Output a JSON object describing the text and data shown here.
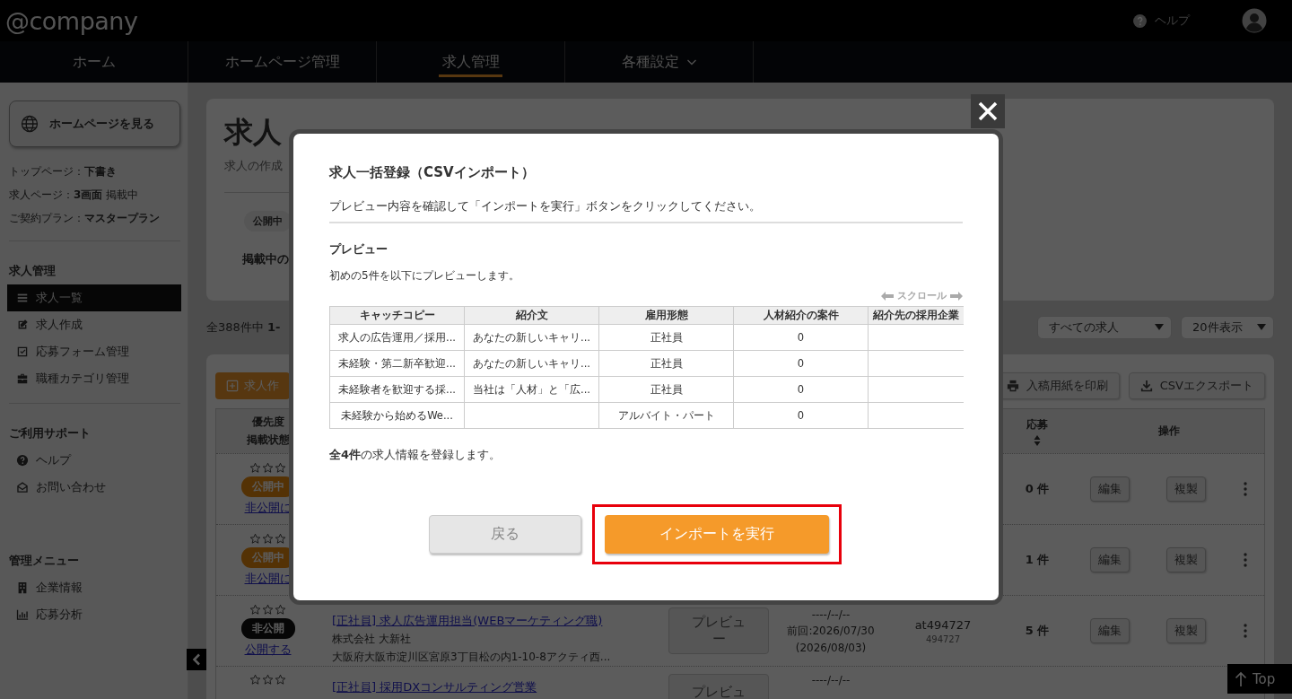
{
  "header": {
    "logo": "@company",
    "help": "ヘルプ"
  },
  "nav": {
    "tabs": [
      {
        "label": "ホーム",
        "selected": false,
        "dropdown": false
      },
      {
        "label": "ホームページ管理",
        "selected": false,
        "dropdown": false
      },
      {
        "label": "求人管理",
        "selected": true,
        "dropdown": false
      },
      {
        "label": "各種設定",
        "selected": false,
        "dropdown": true
      }
    ]
  },
  "sidebar": {
    "view_button": "ホームページを見る",
    "info": [
      "トップページ：**下書き**",
      "求人ページ：**3画面** 掲載中",
      "ご契約プラン：**マスタープラン**"
    ],
    "sections": [
      {
        "title": "求人管理",
        "items": [
          {
            "label": "求人一覧",
            "kind": "list",
            "selected": true
          },
          {
            "label": "求人作成",
            "kind": "edit",
            "selected": false
          },
          {
            "label": "応募フォーム管理",
            "kind": "checkbox",
            "selected": false
          },
          {
            "label": "職種カテゴリ管理",
            "kind": "briefcase",
            "selected": false
          }
        ]
      },
      {
        "title": "ご利用サポート",
        "items": [
          {
            "label": "ヘルプ",
            "kind": "help",
            "selected": false
          },
          {
            "label": "お問い合わせ",
            "kind": "mail",
            "selected": false
          }
        ]
      },
      {
        "title": "管理メニュー",
        "items": [
          {
            "label": "企業情報",
            "kind": "building",
            "selected": false
          },
          {
            "label": "応募分析",
            "kind": "chart",
            "selected": false
          }
        ]
      }
    ]
  },
  "main": {
    "title": "求人",
    "subtitle": "求人の作成",
    "status_pill": "公開中",
    "listing_label": "掲載中の",
    "count_text": "全388件中 **1-**",
    "filters": [
      "すべての求人",
      "20件表示"
    ],
    "create_button": "求人作",
    "toolbar_buttons": [
      "入稿用紙を印刷",
      "CSVエクスポート"
    ],
    "table": {
      "status_header": [
        "優先度",
        "掲載状態"
      ],
      "applications_header": "応募",
      "actions_header": "操作",
      "rows": [
        {
          "stars": 0,
          "status": "公開中",
          "kind": "published",
          "toggle_link": "非公開に",
          "applications": "0 件",
          "edit": "編集",
          "copy": "複製"
        },
        {
          "stars": 0,
          "status": "公開中",
          "kind": "published",
          "toggle_link": "非公開に",
          "applications": "1 件",
          "edit": "編集",
          "copy": "複製"
        },
        {
          "stars": 0,
          "status": "非公開",
          "kind": "private",
          "toggle_link": "公開する",
          "title_link": "[正社員] 求人広告運用担当(WEBマーケティング職)",
          "company": "株式会社 大新社",
          "address": "大阪府大阪市淀川区宮原3丁目松の内1-10-8アクティ西...",
          "preview": "プレビュー",
          "dates": [
            "----/--/--",
            "前回:2026/07/30",
            "(2026/08/03)"
          ],
          "code": "at494727",
          "code_sub": "494727",
          "applications": "5 件",
          "edit": "編集",
          "copy": "複製"
        },
        {
          "stars": 0,
          "title_link": "[正社員] 採用DXコンサルティング営業",
          "preview": "プレビュ",
          "dates": [
            "----/--/--"
          ]
        }
      ]
    }
  },
  "modal": {
    "title": "求人一括登録（CSVインポート）",
    "instruction": "プレビュー内容を確認して「インポートを実行」ボタンをクリックしてください。",
    "preview_heading": "プレビュー",
    "preview_note": "初めの5件を以下にプレビューします。",
    "scroll_hint": "スクロール",
    "table": {
      "columns": [
        "キャッチコピー",
        "紹介文",
        "雇用形態",
        "人材紹介の案件",
        "紹介先の採用企業"
      ],
      "rows": [
        {
          "catch_copy": "求人の広告運用／採用...",
          "intro": "あなたの新しいキャリ...",
          "employment_type": "正社員",
          "agency_cases": "0"
        },
        {
          "catch_copy": "未経験・第二新卒歓迎...",
          "intro": "あなたの新しいキャリ...",
          "employment_type": "正社員",
          "agency_cases": "0"
        },
        {
          "catch_copy": "未経験者を歓迎する採...",
          "intro": "当社は「人材」と「広...",
          "employment_type": "正社員",
          "agency_cases": "0"
        },
        {
          "catch_copy": "未経験から始めるWe...",
          "employment_type": "アルバイト・パート",
          "agency_cases": "0"
        }
      ]
    },
    "summary": "**全4件**の求人情報を登録します。",
    "buttons": [
      {
        "label": "戻る",
        "kind": "secondary",
        "highlighted": false
      },
      {
        "label": "インポートを実行",
        "kind": "primary",
        "highlighted": true
      }
    ]
  },
  "top_button": "Top"
}
